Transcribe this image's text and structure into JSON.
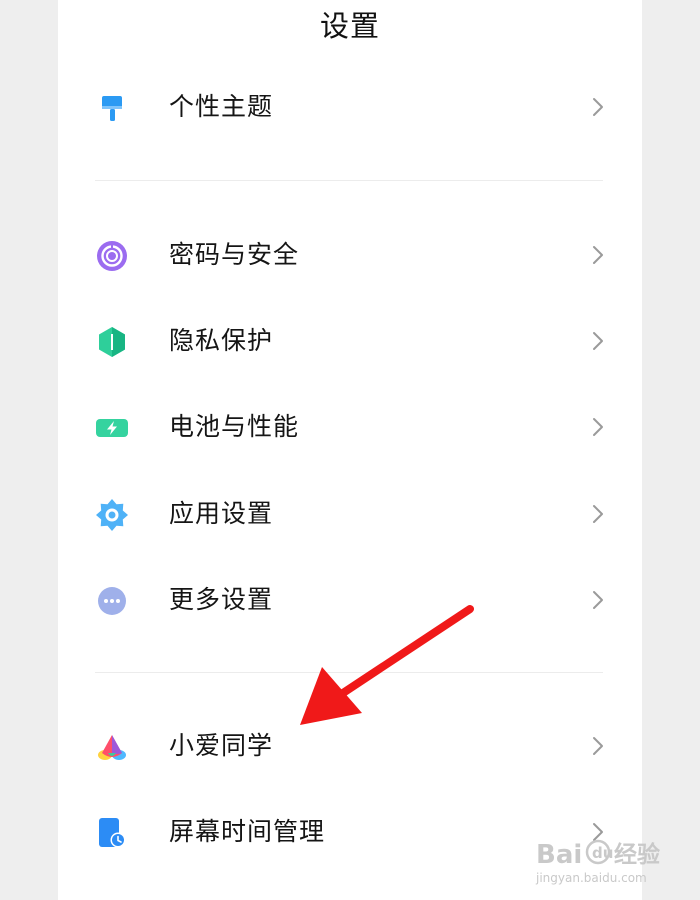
{
  "header": {
    "title": "设置"
  },
  "items": [
    {
      "label": "个性主题",
      "icon": "paint-roller-icon",
      "color": "#2b9af3"
    },
    {
      "label": "密码与安全",
      "icon": "lock-circle-icon",
      "color": "#9b6cf0"
    },
    {
      "label": "隐私保护",
      "icon": "shield-hexagon-icon",
      "color": "#2ecf9a"
    },
    {
      "label": "电池与性能",
      "icon": "battery-icon",
      "color": "#35d39f"
    },
    {
      "label": "应用设置",
      "icon": "gear-icon",
      "color": "#4fb2f7"
    },
    {
      "label": "更多设置",
      "icon": "more-dots-icon",
      "color": "#9fb0ea"
    },
    {
      "label": "小爱同学",
      "icon": "xiaoai-logo-icon",
      "color": "#ff4e6a"
    },
    {
      "label": "屏幕时间管理",
      "icon": "screen-time-icon",
      "color": "#2c8cf5"
    }
  ],
  "annotation": {
    "icon": "red-arrow-icon",
    "color": "#f01919"
  },
  "watermark": {
    "brand": "Bai",
    "brand2": "经验",
    "url": "jingyan.baidu.com"
  }
}
